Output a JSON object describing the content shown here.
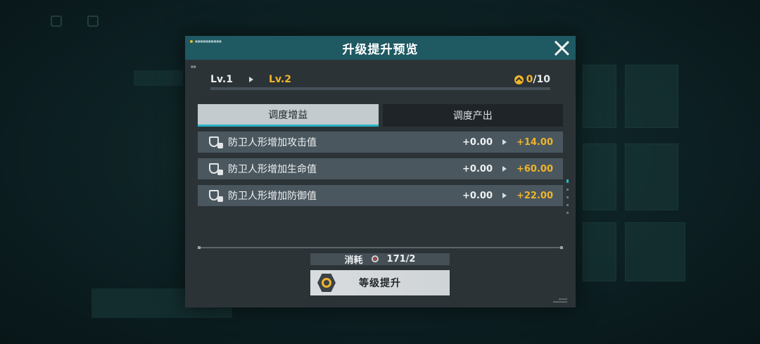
{
  "header": {
    "title": "升级提升预览",
    "tag_text": "■■■■■■■■■■"
  },
  "level": {
    "from": "Lv.1",
    "to": "Lv.2",
    "progress_current": "0",
    "progress_total": "/10",
    "progress_fraction": 0
  },
  "tabs": [
    {
      "label": "调度增益",
      "active": true
    },
    {
      "label": "调度产出",
      "active": false
    }
  ],
  "stats": [
    {
      "name": "防卫人形增加攻击值",
      "old": "+0.00",
      "new": "+14.00",
      "icon": "attack-shield-icon"
    },
    {
      "name": "防卫人形增加生命值",
      "old": "+0.00",
      "new": "+60.00",
      "icon": "health-shield-icon"
    },
    {
      "name": "防卫人形增加防御值",
      "old": "+0.00",
      "new": "+22.00",
      "icon": "defense-shield-icon"
    }
  ],
  "cost": {
    "label": "消耗",
    "amount": "171/2",
    "icon": "material-item-icon"
  },
  "upgrade_button": {
    "label": "等级提升",
    "icon": "hexagon-coin-icon"
  },
  "colors": {
    "accent": "#f0b429",
    "header": "#1f5962",
    "panel": "#2c3337",
    "tab_underline": "#2bb3c3"
  }
}
